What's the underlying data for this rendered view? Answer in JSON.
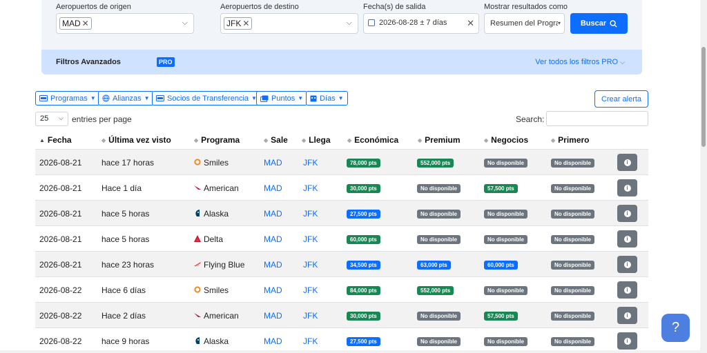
{
  "search": {
    "origin_label": "Aeropuertos de origen",
    "origin_value": "MAD",
    "dest_label": "Aeropuertos de destino",
    "dest_value": "JFK",
    "date_label": "Fecha(s) de salida",
    "date_value": "2026-08-28  ±  7 días",
    "show_label": "Mostrar resultados como",
    "show_value": "Resumen del Programa",
    "search_button": "Buscar",
    "advanced_title": "Filtros Avanzados",
    "advanced_badge": "PRO",
    "advanced_link": "Ver todos los filtros PRO"
  },
  "filters": {
    "programas": "Programas",
    "alianzas": "Alianzas",
    "socios": "Socios de Transferencia",
    "puntos": "Puntos",
    "dias": "Días",
    "crear_alerta": "Crear alerta"
  },
  "table_controls": {
    "entries_value": "25",
    "entries_label": "entries per page",
    "search_label": "Search:"
  },
  "columns": [
    "Fecha",
    "Última vez visto",
    "Programa",
    "Sale",
    "Llega",
    "Económica",
    "Premium",
    "Negocios",
    "Primero"
  ],
  "rows": [
    {
      "fecha": "2026-08-21",
      "visto": "hace 17 horas",
      "programa": "Smiles",
      "logo": "smiles",
      "sale": "MAD",
      "llega": "JFK",
      "eco": {
        "t": "78,000 pts",
        "c": "green"
      },
      "prem": {
        "t": "552,000 pts",
        "c": "green"
      },
      "neg": {
        "t": "No disponible",
        "c": "gray"
      },
      "pri": {
        "t": "No disponible",
        "c": "gray"
      }
    },
    {
      "fecha": "2026-08-21",
      "visto": "Hace 1 día",
      "programa": "American",
      "logo": "american",
      "sale": "MAD",
      "llega": "JFK",
      "eco": {
        "t": "30,000 pts",
        "c": "green"
      },
      "prem": {
        "t": "No disponible",
        "c": "gray"
      },
      "neg": {
        "t": "57,500 pts",
        "c": "green"
      },
      "pri": {
        "t": "No disponible",
        "c": "gray"
      }
    },
    {
      "fecha": "2026-08-21",
      "visto": "hace 5 horas",
      "programa": "Alaska",
      "logo": "alaska",
      "sale": "MAD",
      "llega": "JFK",
      "eco": {
        "t": "27,500 pts",
        "c": "blue"
      },
      "prem": {
        "t": "No disponible",
        "c": "gray"
      },
      "neg": {
        "t": "No disponible",
        "c": "gray"
      },
      "pri": {
        "t": "No disponible",
        "c": "gray"
      }
    },
    {
      "fecha": "2026-08-21",
      "visto": "hace 5 horas",
      "programa": "Delta",
      "logo": "delta",
      "sale": "MAD",
      "llega": "JFK",
      "eco": {
        "t": "60,000 pts",
        "c": "green"
      },
      "prem": {
        "t": "No disponible",
        "c": "gray"
      },
      "neg": {
        "t": "No disponible",
        "c": "gray"
      },
      "pri": {
        "t": "No disponible",
        "c": "gray"
      }
    },
    {
      "fecha": "2026-08-21",
      "visto": "hace 23 horas",
      "programa": "Flying Blue",
      "logo": "flyingblue",
      "sale": "MAD",
      "llega": "JFK",
      "eco": {
        "t": "34,500 pts",
        "c": "blue"
      },
      "prem": {
        "t": "63,000 pts",
        "c": "blue"
      },
      "neg": {
        "t": "60,000 pts",
        "c": "blue"
      },
      "pri": {
        "t": "No disponible",
        "c": "gray"
      }
    },
    {
      "fecha": "2026-08-22",
      "visto": "Hace 6 días",
      "programa": "Smiles",
      "logo": "smiles",
      "sale": "MAD",
      "llega": "JFK",
      "eco": {
        "t": "84,000 pts",
        "c": "green"
      },
      "prem": {
        "t": "552,000 pts",
        "c": "green"
      },
      "neg": {
        "t": "No disponible",
        "c": "gray"
      },
      "pri": {
        "t": "No disponible",
        "c": "gray"
      }
    },
    {
      "fecha": "2026-08-22",
      "visto": "Hace 2 días",
      "programa": "American",
      "logo": "american",
      "sale": "MAD",
      "llega": "JFK",
      "eco": {
        "t": "30,000 pts",
        "c": "green"
      },
      "prem": {
        "t": "No disponible",
        "c": "gray"
      },
      "neg": {
        "t": "57,500 pts",
        "c": "green"
      },
      "pri": {
        "t": "No disponible",
        "c": "gray"
      }
    },
    {
      "fecha": "2026-08-22",
      "visto": "hace 9 horas",
      "programa": "Alaska",
      "logo": "alaska",
      "sale": "MAD",
      "llega": "JFK",
      "eco": {
        "t": "27,500 pts",
        "c": "blue"
      },
      "prem": {
        "t": "No disponible",
        "c": "gray"
      },
      "neg": {
        "t": "No disponible",
        "c": "gray"
      },
      "pri": {
        "t": "No disponible",
        "c": "gray"
      }
    }
  ],
  "help_button": "?"
}
